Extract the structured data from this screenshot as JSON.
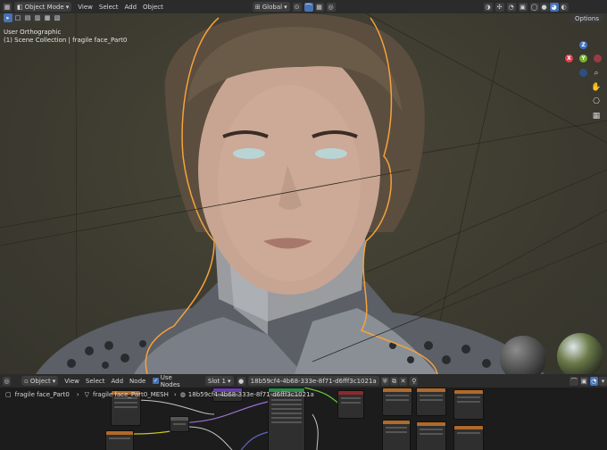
{
  "header": {
    "mode": "Object Mode",
    "menus": [
      "View",
      "Select",
      "Add",
      "Object"
    ],
    "transform_orientation": "Global",
    "options_label": "Options"
  },
  "viewport": {
    "view_name": "User Orthographic",
    "collection_info": "(1) Scene Collection | fragile face_Part0",
    "gizmo_axes": [
      "X",
      "Y",
      "Z"
    ]
  },
  "node_editor": {
    "object_type": "Object",
    "menus": [
      "View",
      "Select",
      "Add",
      "Node"
    ],
    "use_nodes_label": "Use Nodes",
    "slot": "Slot 1",
    "material_name": "18b59cf4-4b68-333e-8f71-d6fff3c1021a",
    "breadcrumb": {
      "object": "fragile face_Part0",
      "mesh": "fragile face_Part0_MESH",
      "material": "18b59cf4-4b68-333e-8f71-d6fff3c1021a"
    }
  },
  "colors": {
    "accent": "#4772b3",
    "selection_outline": "#f5a23c",
    "axis_x": "#e0414e",
    "axis_y": "#7ab32b",
    "axis_z": "#3f73c5"
  }
}
